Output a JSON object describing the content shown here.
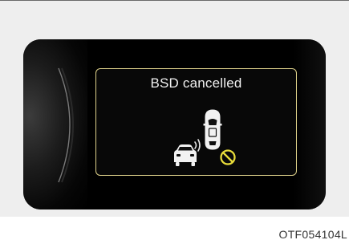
{
  "popup": {
    "message": "BSD cancelled"
  },
  "figure": {
    "code": "OTF054104L"
  },
  "icons": {
    "own_vehicle": "car-top-view-icon",
    "rear_vehicle": "car-front-view-icon",
    "sensor_waves": "radar-wave-icon",
    "cancel": "prohibited-icon"
  },
  "colors": {
    "popup_border": "#ded18a",
    "cancel_symbol": "#e8dc3a",
    "text": "#f0f0f0"
  }
}
